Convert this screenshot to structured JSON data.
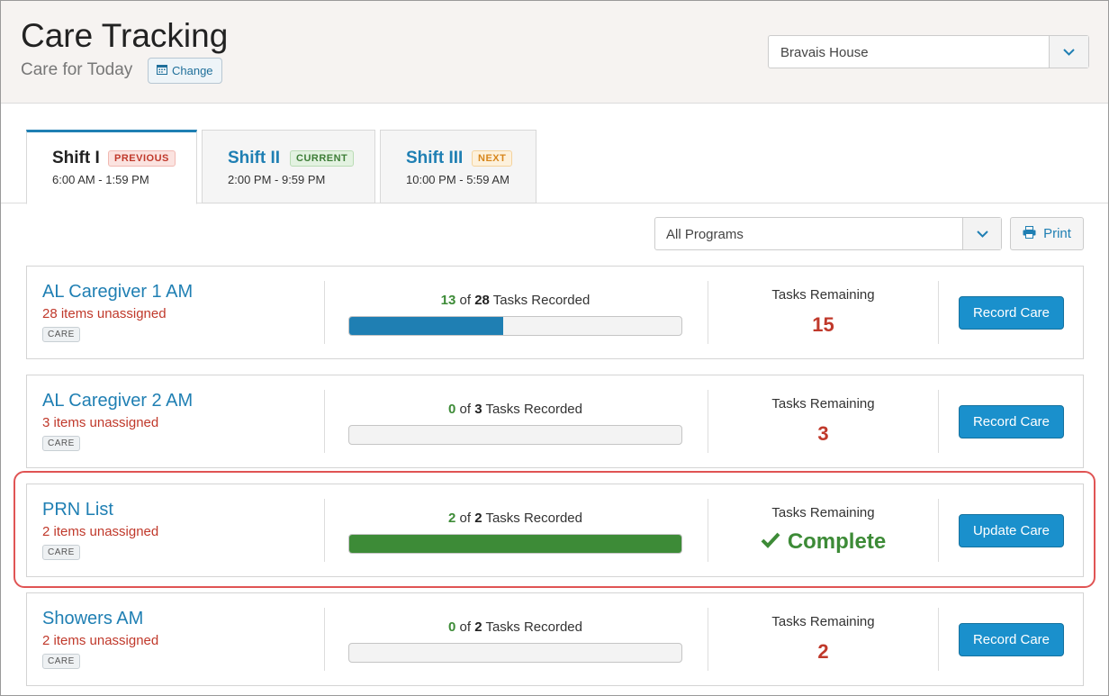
{
  "header": {
    "title": "Care Tracking",
    "subtitle": "Care for Today",
    "change_label": "Change",
    "house_selected": "Bravais House"
  },
  "tabs": [
    {
      "name": "Shift I",
      "badge": "PREVIOUS",
      "time": "6:00 AM - 1:59 PM",
      "active": true
    },
    {
      "name": "Shift II",
      "badge": "CURRENT",
      "time": "2:00 PM - 9:59 PM",
      "active": false
    },
    {
      "name": "Shift III",
      "badge": "NEXT",
      "time": "10:00 PM - 5:59 AM",
      "active": false
    }
  ],
  "filter": {
    "program_selected": "All Programs",
    "print_label": "Print"
  },
  "care_lists": [
    {
      "name": "AL Caregiver 1 AM",
      "unassigned": "28 items unassigned",
      "tag": "CARE",
      "done": "13",
      "of": "of",
      "total": "28",
      "recorded_suffix": "Tasks Recorded",
      "progress": 0.464,
      "remaining_label": "Tasks Remaining",
      "remaining": "15",
      "action": "Record Care"
    },
    {
      "name": "AL Caregiver 2 AM",
      "unassigned": "3 items unassigned",
      "tag": "CARE",
      "done": "0",
      "of": "of",
      "total": "3",
      "recorded_suffix": "Tasks Recorded",
      "progress": 0,
      "remaining_label": "Tasks Remaining",
      "remaining": "3",
      "action": "Record Care"
    },
    {
      "name": "PRN List",
      "unassigned": "2 items unassigned",
      "tag": "CARE",
      "done": "2",
      "of": "of",
      "total": "2",
      "recorded_suffix": "Tasks Recorded",
      "progress": 1,
      "remaining_label": "Tasks Remaining",
      "remaining": "Complete",
      "action": "Update Care"
    },
    {
      "name": "Showers AM",
      "unassigned": "2 items unassigned",
      "tag": "CARE",
      "done": "0",
      "of": "of",
      "total": "2",
      "recorded_suffix": "Tasks Recorded",
      "progress": 0,
      "remaining_label": "Tasks Remaining",
      "remaining": "2",
      "action": "Record Care"
    }
  ],
  "colors": {
    "accent": "#1f7fb3",
    "danger": "#c0392b",
    "success": "#3d8b37",
    "highlight": "#e05454"
  }
}
